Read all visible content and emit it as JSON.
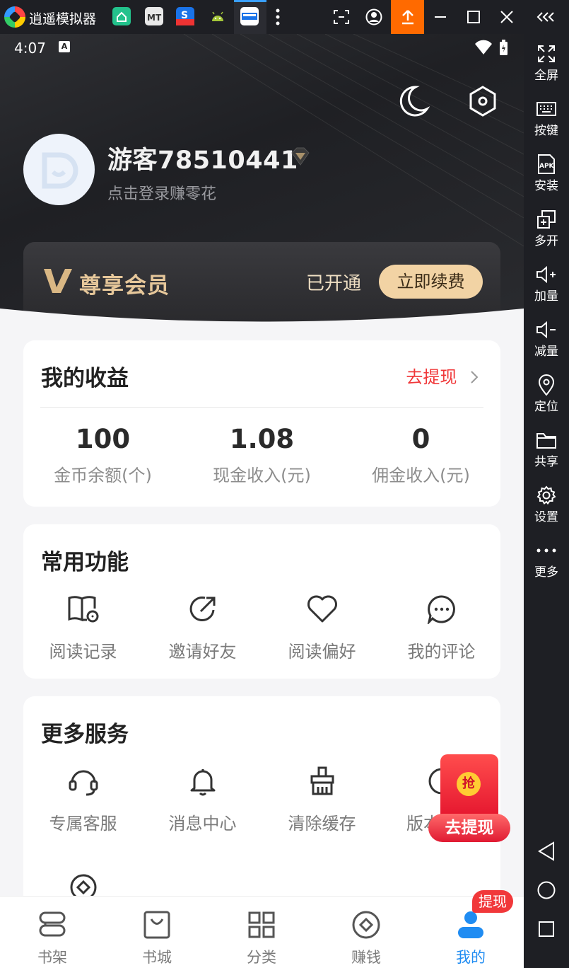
{
  "emulator": {
    "title": "逍遥模拟器",
    "sidebar": [
      "全屏",
      "按键",
      "安装",
      "多开",
      "加量",
      "减量",
      "定位",
      "共享",
      "设置",
      "更多"
    ]
  },
  "status_bar": {
    "time": "4:07"
  },
  "profile": {
    "username": "游客78510441",
    "hint": "点击登录赚零花"
  },
  "vip": {
    "title": "尊享会员",
    "status": "已开通",
    "button": "立即续费"
  },
  "earnings": {
    "title": "我的收益",
    "withdraw_link": "去提现",
    "stats": [
      {
        "value": "100",
        "label": "金币余额(个)"
      },
      {
        "value": "1.08",
        "label": "现金收入(元)"
      },
      {
        "value": "0",
        "label": "佣金收入(元)"
      }
    ]
  },
  "common_functions": {
    "title": "常用功能",
    "items": [
      "阅读记录",
      "邀请好友",
      "阅读偏好",
      "我的评论"
    ]
  },
  "more_services": {
    "title": "更多服务",
    "items": [
      "专属客服",
      "消息中心",
      "清除缓存",
      "版本"
    ]
  },
  "float_redpacket": {
    "coin": "抢",
    "button": "去提现"
  },
  "tabbar": {
    "tabs": [
      "书架",
      "书城",
      "分类",
      "赚钱",
      "我的"
    ],
    "badge": "提现",
    "active_color": "#1f8cf2"
  },
  "colors": {
    "accent_red": "#f0383a",
    "vip_gold": "#f2d3a4",
    "dark_header": "#2a2b2f"
  }
}
